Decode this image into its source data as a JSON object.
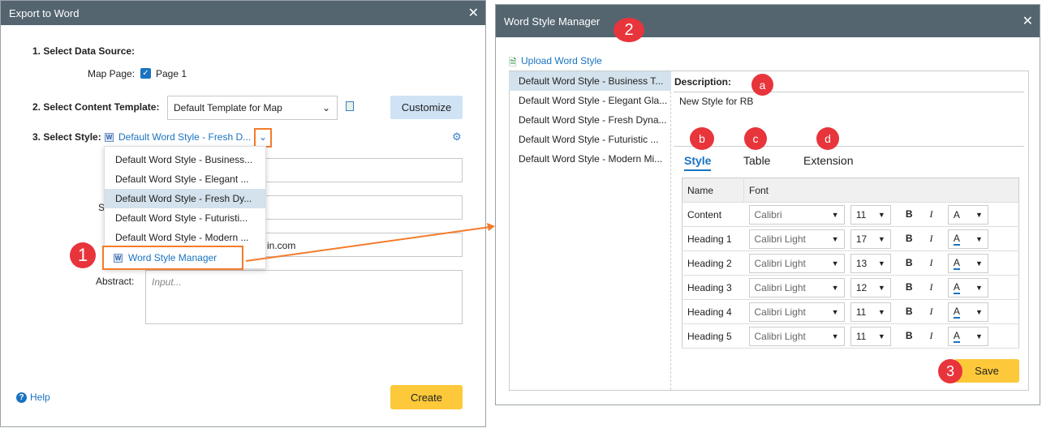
{
  "export_dialog": {
    "title": "Export to Word",
    "step1": "1. Select Data Source:",
    "map_page_label": "Map Page:",
    "page_option": "Page 1",
    "page_checked": true,
    "step2": "2. Select Content Template:",
    "template_value": "Default Template for Map",
    "customize": "Customize",
    "step3": "3. Select Style:",
    "style_value": "Default Word Style - Fresh D...",
    "style_options": [
      "Default Word Style - Business...",
      "Default Word Style - Elegant ...",
      "Default Word Style - Fresh Dy...",
      "Default Word Style - Futuristi...",
      "Default Word Style - Modern ..."
    ],
    "manager_item": "Word Style Manager",
    "subject_label_partial": "S",
    "email_partial": "in.com",
    "abstract_label": "Abstract:",
    "abstract_placeholder": "Input...",
    "help": "Help",
    "create": "Create"
  },
  "manager": {
    "title": "Word Style Manager",
    "upload": "Upload Word Style",
    "styles": [
      "Default Word Style - Business T...",
      "Default Word Style - Elegant Gla...",
      "Default Word Style - Fresh Dyna...",
      "Default Word Style - Futuristic ...",
      "Default Word Style - Modern Mi..."
    ],
    "description_label": "Description:",
    "description": "New Style for RB",
    "tabs": [
      "Style",
      "Table",
      "Extension"
    ],
    "columns": [
      "Name",
      "Font"
    ],
    "rows": [
      {
        "name": "Content",
        "font": "Calibri",
        "size": "11"
      },
      {
        "name": "Heading 1",
        "font": "Calibri Light",
        "size": "17"
      },
      {
        "name": "Heading 2",
        "font": "Calibri Light",
        "size": "13"
      },
      {
        "name": "Heading 3",
        "font": "Calibri Light",
        "size": "12"
      },
      {
        "name": "Heading 4",
        "font": "Calibri Light",
        "size": "11"
      },
      {
        "name": "Heading 5",
        "font": "Calibri Light",
        "size": "11"
      }
    ],
    "bold": "B",
    "italic": "I",
    "color": "A",
    "save": "Save"
  },
  "annotations": {
    "n1": "1",
    "n2": "2",
    "n3": "3",
    "a": "a",
    "b": "b",
    "c": "c",
    "d": "d"
  },
  "colors": {
    "header": "#546570",
    "accent": "#1a73c0",
    "highlight": "#f47b2a",
    "button": "#fdc93a"
  }
}
